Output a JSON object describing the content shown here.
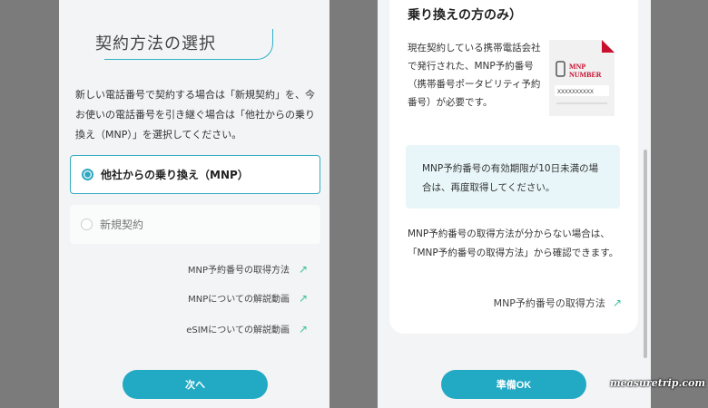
{
  "left": {
    "title": "契約方法の選択",
    "intro": "新しい電話番号で契約する場合は「新規契約」を、今お使いの電話番号を引き継ぐ場合は「他社からの乗り換え（MNP）」を選択してください。",
    "options": [
      {
        "label": "他社からの乗り換え（MNP）",
        "selected": true
      },
      {
        "label": "新規契約",
        "selected": false
      }
    ],
    "links": [
      {
        "label": "MNP予約番号の取得方法",
        "icon": "external-arrow-icon"
      },
      {
        "label": "MNPについての解説動画",
        "icon": "external-arrow-icon"
      },
      {
        "label": "eSIMについての解説動画",
        "icon": "external-arrow-icon"
      }
    ],
    "next_button": "次へ"
  },
  "right": {
    "heading": "乗り換えの方のみ）",
    "body": "現在契約している携帯電話会社で発行された、MNP予約番号（携帯番号ポータビリティ予約番号）が必要です。",
    "doc_image": {
      "line1": "MNP",
      "line2": "NUMBER",
      "placeholder": "XXXXXXXXXX"
    },
    "notice": "MNP予約番号の有効期限が10日未満の場合は、再度取得してください。",
    "howto": "MNP予約番号の取得方法が分からない場合は、「MNP予約番号の取得方法」から確認できます。",
    "link": "MNP予約番号の取得方法",
    "ok_button": "準備OK"
  },
  "watermark": "measuretrip.com",
  "colors": {
    "accent": "#22a9c4",
    "arrow": "#3bbfa0",
    "notice_bg": "#e8f6f9",
    "doc_red": "#c8102e"
  }
}
